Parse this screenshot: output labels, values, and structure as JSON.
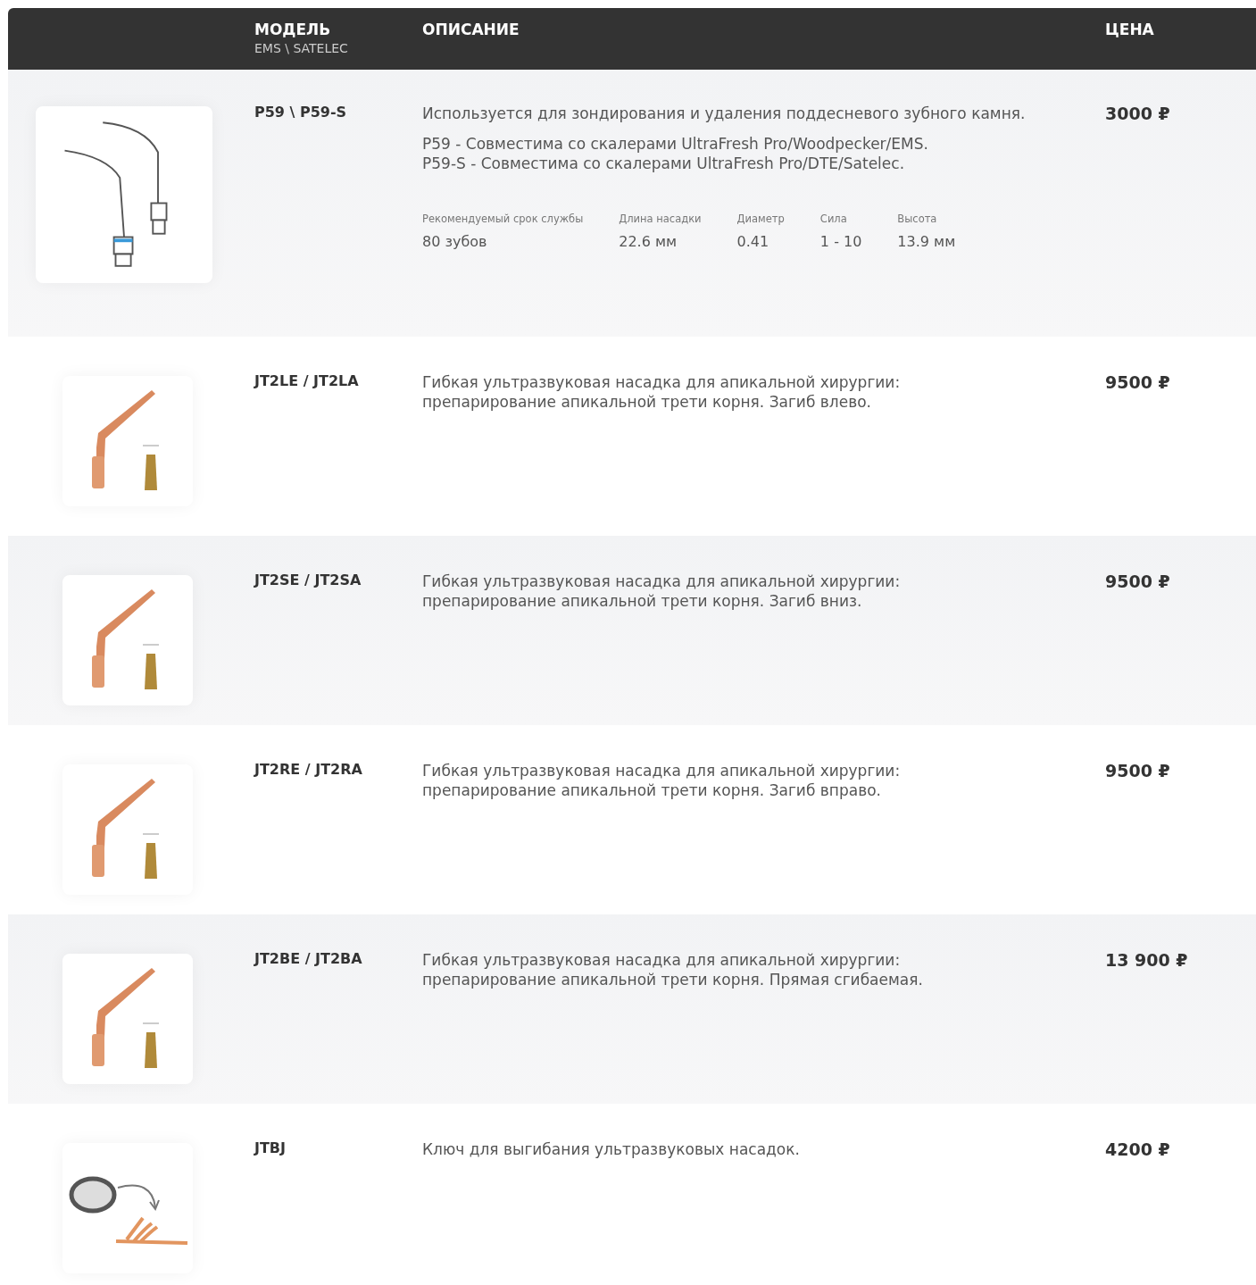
{
  "table": {
    "columns": [
      {
        "title": "МОДЕЛЬ",
        "subtitle": "EMS \\ SATELEC"
      },
      {
        "title": "ОПИСАНИЕ"
      },
      {
        "title": "ЦЕНА"
      }
    ],
    "rows": [
      {
        "kind": "scaler",
        "model": "P59 \\ P59-S",
        "description": [
          "Используется для зондирования и удаления поддесневого зубного камня.",
          "P59 - Совместима со скалерами UltraFresh Pro/Woodpecker/EMS.\nP59-S - Совместима со скалерами UltraFresh Pro/DTE/Satelec."
        ],
        "specs": [
          {
            "label": "Рекомендуемый срок службы",
            "value": "80 зубов"
          },
          {
            "label": "Длина насадки",
            "value": "22.6 мм"
          },
          {
            "label": "Диаметр",
            "value": "0.41"
          },
          {
            "label": "Сила",
            "value": "1 - 10"
          },
          {
            "label": "Высота",
            "value": "13.9 мм"
          }
        ],
        "price": "3000 ₽"
      },
      {
        "kind": "tip",
        "model": "JT2LE / JT2LA",
        "description": [
          "Гибкая ультразвуковая насадка для апикальной хирургии: препарирование апикальной трети корня. Загиб влево."
        ],
        "price": "9500 ₽"
      },
      {
        "kind": "tip",
        "model": "JT2SE / JT2SA",
        "description": [
          "Гибкая ультразвуковая насадка для апикальной хирургии: препарирование апикальной трети корня. Загиб вниз."
        ],
        "price": "9500 ₽"
      },
      {
        "kind": "tip",
        "model": "JT2RE / JT2RA",
        "description": [
          "Гибкая ультразвуковая насадка для апикальной хирургии: препарирование апикальной трети корня. Загиб вправо."
        ],
        "price": "9500 ₽"
      },
      {
        "kind": "tip",
        "model": "JT2BE / JT2BA",
        "description": [
          "Гибкая ультразвуковая насадка для апикальной хирургии: препарирование апикальной трети корня. Прямая сгибаемая."
        ],
        "price": "13 900 ₽"
      },
      {
        "kind": "key",
        "model": "JTBJ",
        "description": [
          "Ключ для выгибания ультразвуковых насадок."
        ],
        "price": "4200 ₽"
      }
    ]
  }
}
